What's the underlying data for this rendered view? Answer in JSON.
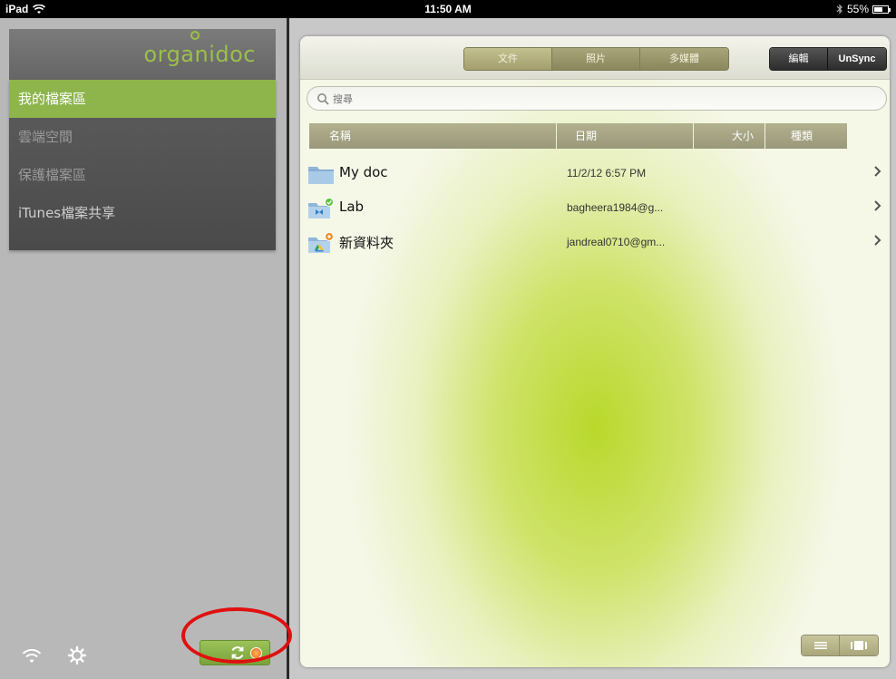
{
  "status_bar": {
    "device": "iPad",
    "time": "11:50 AM",
    "battery": "55%"
  },
  "sidebar": {
    "logo": "organidoc",
    "items": [
      {
        "label": "我的檔案區",
        "active": true
      },
      {
        "label": "雲端空間",
        "active": false
      },
      {
        "label": "保護檔案區",
        "active": false
      },
      {
        "label": "iTunes檔案共享",
        "active": false
      }
    ]
  },
  "toolbar": {
    "segments": [
      "文件",
      "照片",
      "多媒體"
    ],
    "edit_label": "編輯",
    "unsync_label": "UnSync"
  },
  "search": {
    "placeholder": "搜尋"
  },
  "table": {
    "headers": {
      "name": "名稱",
      "date": "日期",
      "size": "大小",
      "type": "種類"
    },
    "rows": [
      {
        "name": "My doc",
        "date": "11/2/12 6:57 PM",
        "icon": "folder-icon"
      },
      {
        "name": "Lab",
        "date": "bagheera1984@g...",
        "icon": "dropbox-folder-icon"
      },
      {
        "name": "新資料夾",
        "date": "jandreal0710@gm...",
        "icon": "google-drive-folder-icon"
      }
    ]
  },
  "colors": {
    "accent_green": "#8db54c",
    "logo_green": "#9bbf4a",
    "highlight_ring": "#e01010"
  }
}
